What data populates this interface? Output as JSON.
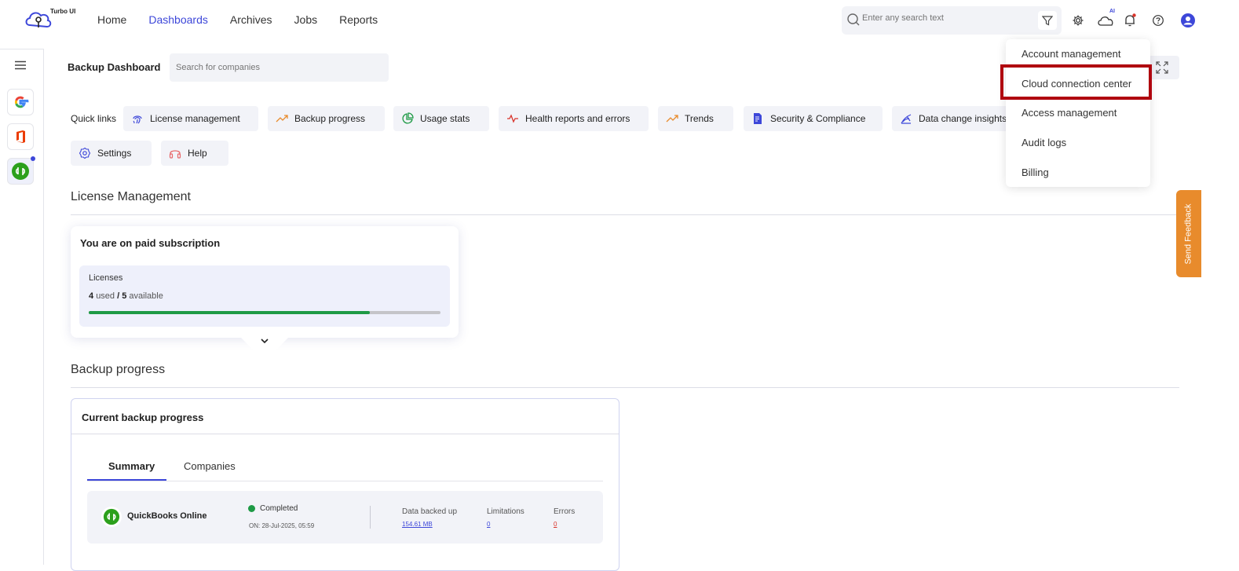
{
  "app": {
    "logo_text": "Turbo UI"
  },
  "nav": {
    "items": [
      "Home",
      "Dashboards",
      "Archives",
      "Jobs",
      "Reports"
    ],
    "active": "Dashboards"
  },
  "global_search": {
    "placeholder": "Enter any search text"
  },
  "topbar_icons": [
    "filter-icon",
    "gear-icon",
    "ai-cloud-icon",
    "bell-icon",
    "help-icon",
    "user-icon"
  ],
  "ai_badge": "AI",
  "sidebar": {
    "items": [
      "google-icon",
      "office-icon",
      "quickbooks-icon"
    ]
  },
  "dashboard": {
    "title": "Backup Dashboard",
    "company_search_placeholder": "Search for companies"
  },
  "quick_links": {
    "label": "Quick links",
    "items": [
      {
        "label": "License management",
        "icon": "fingerprint-icon"
      },
      {
        "label": "Backup progress",
        "icon": "trend-up-icon"
      },
      {
        "label": "Usage stats",
        "icon": "pie-icon"
      },
      {
        "label": "Health reports and errors",
        "icon": "pulse-icon"
      },
      {
        "label": "Trends",
        "icon": "trend-up-icon"
      },
      {
        "label": "Security & Compliance",
        "icon": "document-shield-icon"
      },
      {
        "label": "Data change insights",
        "icon": "radar-icon"
      },
      {
        "label": "Settings",
        "icon": "gear-icon"
      },
      {
        "label": "Help",
        "icon": "headset-icon"
      }
    ]
  },
  "license": {
    "section_title": "License Management",
    "card_title": "You are on paid subscription",
    "label": "Licenses",
    "used": "4",
    "used_word": "used",
    "sep": "/",
    "available": "5",
    "available_word": "available",
    "fraction_used": 0.8
  },
  "backup": {
    "section_title": "Backup progress",
    "card_title": "Current backup progress",
    "tabs": [
      "Summary",
      "Companies"
    ],
    "active_tab": "Summary",
    "row": {
      "name": "QuickBooks Online",
      "status": "Completed",
      "time": "ON: 28-Jul-2025, 05:59",
      "data_label": "Data backed up",
      "data_value": "154.61 MB",
      "limitations_label": "Limitations",
      "limitations_value": "0",
      "errors_label": "Errors",
      "errors_value": "0"
    }
  },
  "dropdown": {
    "items": [
      "Account management",
      "Cloud connection center",
      "Access management",
      "Audit logs",
      "Billing"
    ],
    "highlighted": "Cloud connection center"
  },
  "feedback": {
    "label": "Send Feedback"
  },
  "colors": {
    "accent": "#3d47d9",
    "success": "#1e9a45",
    "highlight": "#b0060f",
    "feedback": "#e88b2c",
    "error": "#d9342b"
  }
}
